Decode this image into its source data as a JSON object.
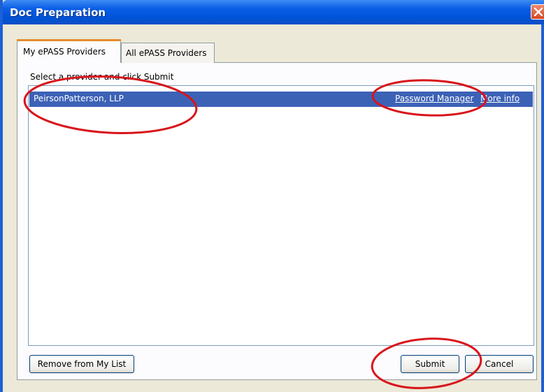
{
  "window": {
    "title": "Doc Preparation"
  },
  "tabs": [
    {
      "label": "My ePASS Providers",
      "active": true
    },
    {
      "label": "All ePASS Providers",
      "active": false
    }
  ],
  "panel": {
    "instruction": "Select a provider and click Submit",
    "providers": [
      {
        "name": "PeirsonPatterson, LLP",
        "selected": true,
        "links": [
          "Password Manager",
          "More info"
        ]
      }
    ]
  },
  "buttons": {
    "remove": "Remove from My List",
    "submit": "Submit",
    "cancel": "Cancel"
  },
  "colors": {
    "title_bar": "#0a5ee6",
    "selection": "#3c62b6",
    "annotation": "#d9141b",
    "active_tab_accent": "#e68b2c"
  },
  "icons": {
    "close": "close-icon"
  }
}
